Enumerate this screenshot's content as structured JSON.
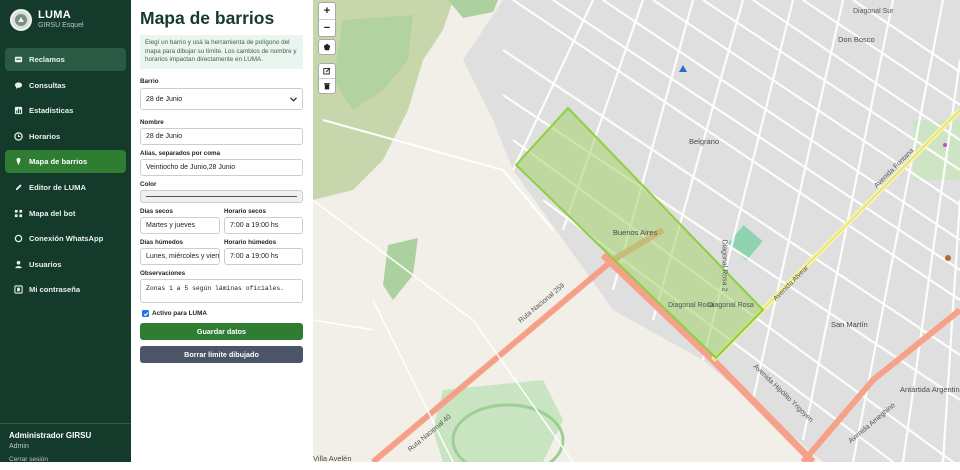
{
  "brand": {
    "title": "LUMA",
    "subtitle": "GIRSU Esquel"
  },
  "nav": [
    {
      "label": "Reclamos",
      "icon": "inbox-icon"
    },
    {
      "label": "Consultas",
      "icon": "chat-icon"
    },
    {
      "label": "Estadísticas",
      "icon": "chart-icon"
    },
    {
      "label": "Horarios",
      "icon": "clock-icon"
    },
    {
      "label": "Mapa de barrios",
      "icon": "location-icon"
    },
    {
      "label": "Editor de LUMA",
      "icon": "pencil-icon"
    },
    {
      "label": "Mapa del bot",
      "icon": "sitemap-icon"
    },
    {
      "label": "Conexión WhatsApp",
      "icon": "link-icon"
    },
    {
      "label": "Usuarios",
      "icon": "user-icon"
    },
    {
      "label": "Mi contraseña",
      "icon": "key-icon"
    }
  ],
  "user": {
    "name": "Administrador GIRSU",
    "role": "Admin",
    "extra": "Cerrar sesión"
  },
  "panel": {
    "title": "Mapa de barrios",
    "notice": "Elegí un barrio y usá la herramienta de polígono del mapa para dibujar su límite. Los cambios de nombre y horarios impactan directamente en LUMA.",
    "barrio_label": "Barrio",
    "barrio_value": "28 de Junio",
    "nombre_label": "Nombre",
    "nombre_value": "28 de Junio",
    "alias_label": "Alias, separados por coma",
    "alias_value": "Veintiocho de Junio,28 Junio",
    "color_label": "Color",
    "color_value": "#555555",
    "dias_secos_label": "Días secos",
    "dias_secos_value": "Martes y jueves",
    "horario_secos_label": "Horario secos",
    "horario_secos_value": "7:00 a 19:00 hs",
    "dias_humedos_label": "Días húmedos",
    "dias_humedos_value": "Lunes, miércoles y viern",
    "horario_humedos_label": "Horario húmedos",
    "horario_humedos_value": "7:00 a 19:00 hs",
    "obs_label": "Observaciones",
    "obs_value": "Zonas 1 a 5 según láminas oficiales.",
    "activo_label": "Activo para LUMA",
    "activo_checked": true,
    "save_label": "Guardar datos",
    "clear_label": "Borrar límite dibujado"
  },
  "map": {
    "zoom_in": "+",
    "zoom_out": "−",
    "labels": [
      "Don Bosco",
      "Belgrano",
      "Buenos Aires",
      "San Martín",
      "Antártida Argentina",
      "Villa Avelén",
      "Avenida Alvear",
      "Avenida Fontana",
      "Avenida Hipólito Yrigoyen",
      "Ruta Nacional 259",
      "Ruta Nacional 40",
      "Avenida Ameghino",
      "Diagonal Sur",
      "Diagonal Roca",
      "Diagonal Rosa",
      "Diagonal Rosa 2"
    ]
  }
}
